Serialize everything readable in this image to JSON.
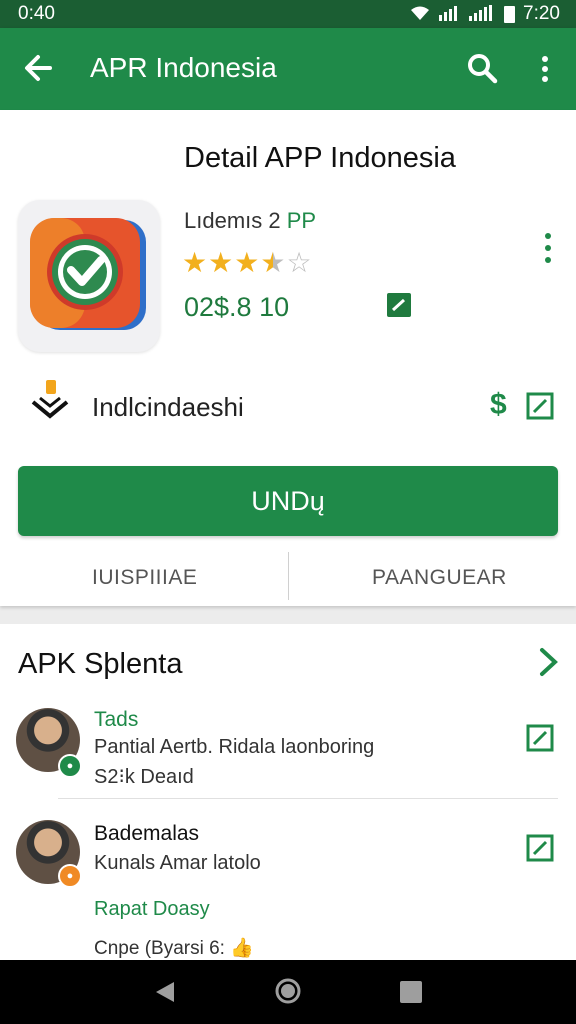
{
  "status_bar": {
    "time_left": "0:40",
    "time_right": "7:20"
  },
  "app_bar": {
    "title": "APR Indonesia"
  },
  "app": {
    "detail_title": "Detail APP Indonesia",
    "name": "Lıdemıs 2",
    "name_suffix": "PP",
    "rating_stars": 3.5,
    "price": "02$.8 10"
  },
  "developer": {
    "name": "Indlcindaeshi",
    "currency_symbol": "$"
  },
  "install_button": {
    "label": "UNDų"
  },
  "sub_actions": {
    "left_label": "IUISPIIIAE",
    "right_label": "PAANGUEAR"
  },
  "section": {
    "title": "APK Sþlenta",
    "items": [
      {
        "name": "Tads",
        "line1": "Pantial Aertb. Ridala laonboring",
        "line2": "S2⁝k Deaıd"
      },
      {
        "name": "Bademalas",
        "line1": "Kunals Amar latolo",
        "line2": "Rapat Doasy",
        "line3": "Cnpe (Byarsi 6:"
      }
    ]
  },
  "colors": {
    "status_bar": "#1b5e33",
    "app_bar": "#1f8a49",
    "accent_green": "#1f8a49",
    "star_gold": "#f2b01e"
  }
}
